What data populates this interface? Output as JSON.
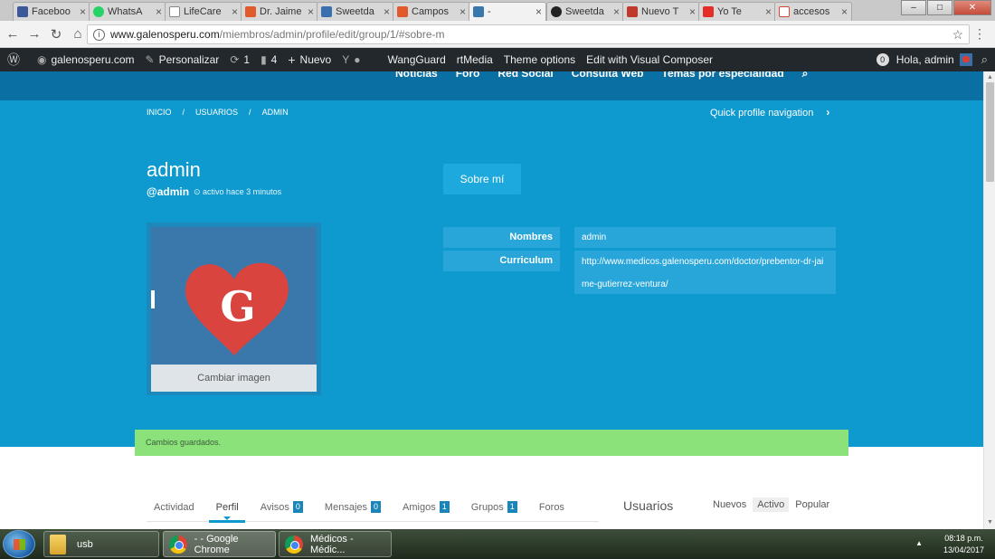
{
  "browser": {
    "tabs": [
      {
        "label": "Faceboo",
        "color": "#3b5998"
      },
      {
        "label": "WhatsA",
        "color": "#25d366"
      },
      {
        "label": "LifeCare",
        "color": "#cccccc"
      },
      {
        "label": "Dr. Jaime",
        "color": "#e05a2b"
      },
      {
        "label": "Sweetda",
        "color": "#3a6fb0"
      },
      {
        "label": "Campos",
        "color": "#e05a2b"
      },
      {
        "label": "-",
        "color": "#3a78ac"
      },
      {
        "label": "Sweetda",
        "color": "#222222"
      },
      {
        "label": "Nuevo T",
        "color": "#c0392b"
      },
      {
        "label": "Yo Te",
        "color": "#e52d27"
      },
      {
        "label": "accesos",
        "color": "#d44638"
      }
    ],
    "url_host": "www.galenosperu.com",
    "url_path": "/miembros/admin/profile/edit/group/1/#sobre-m"
  },
  "wpbar": {
    "site": "galenosperu.com",
    "customize": "Personalizar",
    "updates": "1",
    "comments": "4",
    "new": "Nuevo",
    "wangguard": "WangGuard",
    "rtmedia": "rtMedia",
    "theme_options": "Theme options",
    "visual_composer": "Edit with Visual Composer",
    "notif_count": "0",
    "greeting": "Hola, admin"
  },
  "sitenav": [
    "Noticias",
    "Foro",
    "Red Social",
    "Consulta Web",
    "Temas por especialidad"
  ],
  "breadcrumb": [
    "INICIO",
    "/",
    "USUARIOS",
    "/",
    "ADMIN"
  ],
  "quick_nav": "Quick profile navigation",
  "profile": {
    "name": "admin",
    "handle": "@admin",
    "activity": "activo hace 3 minutos",
    "change_image": "Cambiar imagen",
    "about_button": "Sobre mí",
    "fields": [
      {
        "label": "Nombres",
        "value": "admin"
      },
      {
        "label": "Curriculum",
        "value": "http://www.medicos.galenosperu.com/doctor/prebentor-dr-jaime-gutierrez-ventura/"
      }
    ]
  },
  "notice": "Cambios guardados.",
  "subnav": [
    {
      "label": "Actividad",
      "badge": ""
    },
    {
      "label": "Perfil",
      "badge": ""
    },
    {
      "label": "Avisos",
      "badge": "0"
    },
    {
      "label": "Mensajes",
      "badge": "0"
    },
    {
      "label": "Amigos",
      "badge": "1"
    },
    {
      "label": "Grupos",
      "badge": "1"
    },
    {
      "label": "Foros",
      "badge": ""
    }
  ],
  "widget": {
    "title": "Usuarios",
    "tabs": [
      "Nuevos",
      "Activo",
      "Popular"
    ]
  },
  "taskbar": {
    "items": [
      "usb",
      "- - Google Chrome",
      "Médicos - Médic..."
    ],
    "time": "08:18 p.m.",
    "date": "13/04/2017"
  }
}
